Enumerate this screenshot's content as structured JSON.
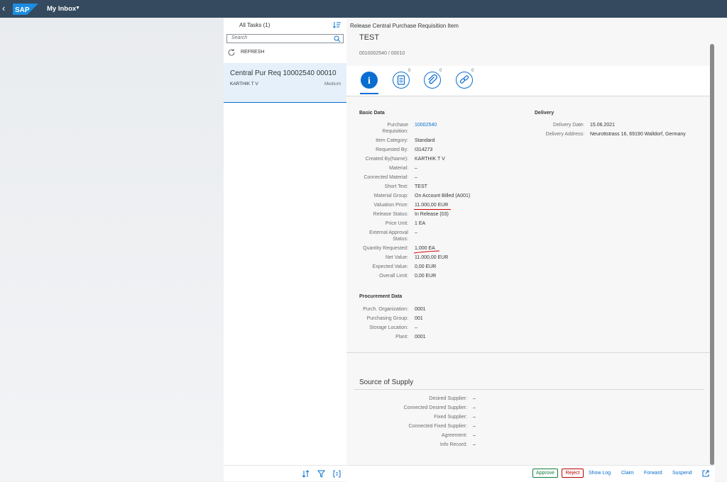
{
  "shell": {
    "title": "My Inbox",
    "logo": "SAP"
  },
  "master": {
    "header": "All Tasks (1)",
    "search_placeholder": "Search",
    "refresh": "REFRESH",
    "item": {
      "title": "Central Pur Req 10002540 00010",
      "created_by": "KARTHIK T V",
      "priority": "Medium"
    }
  },
  "detail": {
    "app_title": "Release Central Purchase Requisition Item",
    "object_title": "TEST",
    "object_number": "0010002540 / 00010",
    "tabs": [
      {
        "icon": "info-icon",
        "count": ""
      },
      {
        "icon": "notes-icon",
        "count": "0"
      },
      {
        "icon": "attachment-icon",
        "count": "0"
      },
      {
        "icon": "link-icon",
        "count": "0"
      }
    ],
    "basic_data": {
      "title": "Basic Data",
      "fields": [
        {
          "label": "Purchase",
          "label2": "Requisition:",
          "value": "10002540"
        },
        {
          "label": "Item Category:",
          "value": "Standard"
        },
        {
          "label": "Requested By:",
          "value": "I314273"
        },
        {
          "label": "Created By(Name):",
          "value": "KARTHIK T V"
        },
        {
          "label": "Material:",
          "value": "–"
        },
        {
          "label": "Connected Material:",
          "value": "–"
        },
        {
          "label": "Short Text:",
          "value": "TEST"
        },
        {
          "label": "Material Group:",
          "value": "On Account Billed (A001)"
        },
        {
          "label": "Valuation Price:",
          "value": "11.000,00  EUR"
        },
        {
          "label": "Release Status:",
          "value": "In Release (03)"
        },
        {
          "label": "Price Unit:",
          "value": "1 EA"
        },
        {
          "label": "External Approval",
          "label2": "Status:",
          "value": "–"
        },
        {
          "label": "Quantity Requested:",
          "value": "1,000 EA"
        },
        {
          "label": "Net Value:",
          "value": "11.000,00  EUR"
        },
        {
          "label": "Expected Value:",
          "value": "0,00  EUR"
        },
        {
          "label": "Overall Limit:",
          "value": "0,00  EUR"
        }
      ]
    },
    "delivery": {
      "title": "Delivery",
      "fields": [
        {
          "label": "Delivery Date:",
          "value": "15.06.2021"
        },
        {
          "label": "Delivery Address:",
          "value": "Neurottstrass 16, 69190 Walldorf, Germany"
        }
      ]
    },
    "procurement": {
      "title": "Procurement Data",
      "fields": [
        {
          "label": "Purch. Organization:",
          "value": "0001"
        },
        {
          "label": "Purchasing Group:",
          "value": "001"
        },
        {
          "label": "Storage Location:",
          "value": "–"
        },
        {
          "label": "Plant:",
          "value": "0001"
        }
      ]
    },
    "source_of_supply": {
      "title": "Source of Supply",
      "fields": [
        {
          "label": "Desired Supplier:",
          "value": "–"
        },
        {
          "label": "Connected Desired Supplier:",
          "value": "–"
        },
        {
          "label": "Fixed Supplier:",
          "value": "–"
        },
        {
          "label": "Connected Fixed Supplier:",
          "value": "–"
        },
        {
          "label": "Agreement:",
          "value": "–"
        },
        {
          "label": "Info Record:",
          "value": "–"
        }
      ]
    },
    "footer": {
      "approve": "Approve",
      "reject": "Reject",
      "show_log": "Show Log",
      "claim": "Claim",
      "forward": "Forward",
      "suspend": "Suspend"
    }
  },
  "colors": {
    "shell": "#354a5f",
    "accent": "#0a6ed1",
    "approve": "#107e3e",
    "reject": "#bb0000",
    "annotation": "#d40000"
  }
}
